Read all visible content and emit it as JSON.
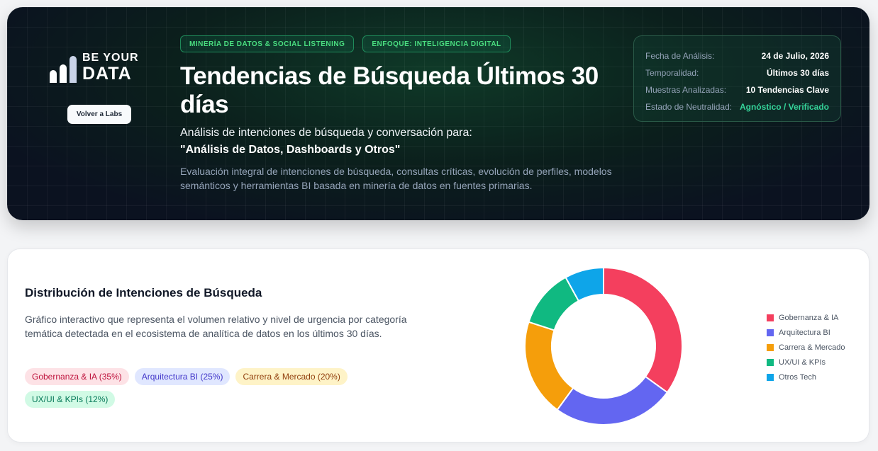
{
  "hero": {
    "logo_line1": "BE YOUR",
    "logo_line2": "DATA",
    "back_label": "Volver a Labs",
    "chip1": "MINERÍA DE DATOS & SOCIAL LISTENING",
    "chip2": "ENFOQUE: INTELIGENCIA DIGITAL",
    "title": "Tendencias de Búsqueda Últimos 30 días",
    "subtitle": "Análisis de intenciones de búsqueda y conversación para:",
    "quote": "\"Análisis de Datos, Dashboards y Otros\"",
    "description": "Evaluación integral de intenciones de búsqueda, consultas críticas, evolución de perfiles, modelos semánticos y herramientas BI basada en minería de datos en fuentes primarias."
  },
  "meta": {
    "rows": [
      {
        "key": "Fecha de Análisis:",
        "value": "24 de Julio, 2026"
      },
      {
        "key": "Temporalidad:",
        "value": "Últimos 30 días"
      },
      {
        "key": "Muestras Analizadas:",
        "value": "10 Tendencias Clave"
      },
      {
        "key": "Estado de Neutralidad:",
        "value": "Agnóstico / Verificado"
      }
    ]
  },
  "section": {
    "title": "Distribución de Intenciones de Búsqueda",
    "description": "Gráfico interactivo que representa el volumen relativo y nivel de urgencia por categoría temática detectada en el ecosistema de analítica de datos en los últimos 30 días.",
    "pills": [
      "Gobernanza & IA (35%)",
      "Arquitectura BI (25%)",
      "Carrera & Mercado (20%)",
      "UX/UI & KPIs (12%)"
    ]
  },
  "chart_data": {
    "type": "pie",
    "donut": true,
    "legend_position": "right",
    "categories": [
      "Gobernanza & IA",
      "Arquitectura BI",
      "Carrera & Mercado",
      "UX/UI & KPIs",
      "Otros Tech"
    ],
    "values": [
      35,
      25,
      20,
      12,
      8
    ],
    "colors": [
      "#f43f5e",
      "#6366f1",
      "#f59e0b",
      "#10b981",
      "#0ea5e9"
    ]
  }
}
